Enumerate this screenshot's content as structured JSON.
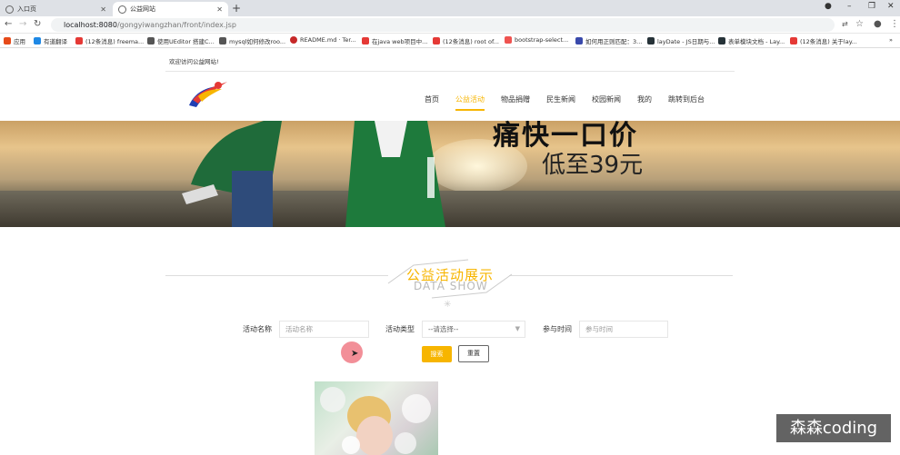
{
  "browser": {
    "tabs": [
      {
        "title": "入口页"
      },
      {
        "title": "公益网站"
      }
    ],
    "new_tab": "+",
    "window_controls": {
      "minimize": "–",
      "restore": "❐",
      "close": "✕"
    },
    "url_host": "localhost:8080",
    "url_path": "/gongyiwangzhan/front/index.jsp",
    "bookmarks": [
      {
        "label": "应用",
        "color": "#e64a19"
      },
      {
        "label": "有道翻译",
        "color": "#1e88e5"
      },
      {
        "label": "(12条消息) freema...",
        "color": "#e53935"
      },
      {
        "label": "使用UEditor 搭建C...",
        "color": "#555555"
      },
      {
        "label": "mysql如何修改roo...",
        "color": "#555555"
      },
      {
        "label": "README.md · Ter...",
        "color": "#c62828"
      },
      {
        "label": "在java web项目中...",
        "color": "#e53935"
      },
      {
        "label": "(12条消息) root of...",
        "color": "#e53935"
      },
      {
        "label": "bootstrap-select...",
        "color": "#ef5350"
      },
      {
        "label": "如何用正则匹配：3...",
        "color": "#3949ab"
      },
      {
        "label": "layDate - JS日期与...",
        "color": "#263238"
      },
      {
        "label": "表单模块文档 - Lay...",
        "color": "#263238"
      },
      {
        "label": "(12条消息) 关于lay...",
        "color": "#e53935"
      }
    ],
    "more": "»"
  },
  "site": {
    "welcome": "欢迎访问公益网站!",
    "nav": [
      "首页",
      "公益活动",
      "物品捐赠",
      "民生新闻",
      "校园新闻",
      "我的",
      "跳转到后台"
    ],
    "active_nav": 1,
    "banner": {
      "headline": "痛快一口价",
      "subline": "低至39元"
    },
    "section": {
      "title": "公益活动展示",
      "subtitle": "DATA SHOW"
    },
    "search": {
      "name_label": "活动名称",
      "name_placeholder": "活动名称",
      "type_label": "活动类型",
      "type_value": "--请选择--",
      "time_label": "参与时间",
      "time_placeholder": "参与时间",
      "search_button": "搜索",
      "reset_button": "重置"
    },
    "watermark": "森森coding"
  },
  "colors": {
    "accent": "#f7b500"
  }
}
